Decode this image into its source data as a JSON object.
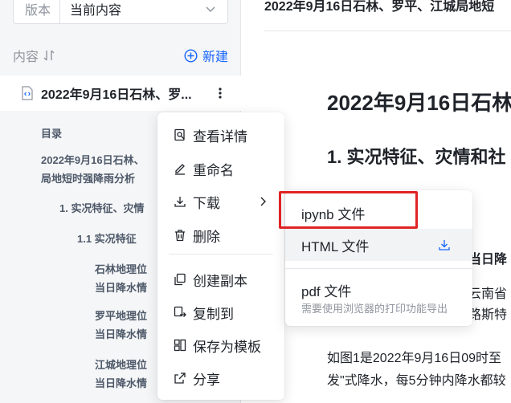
{
  "sidebar": {
    "version_label": "版本",
    "version_value": "当前内容",
    "content_title": "内容",
    "new_label": "新建",
    "file_title": "2022年9月16日石林、罗...",
    "toc_label": "目录",
    "toc": [
      "2022年9月16日石林、",
      "局地短时强降雨分析",
      "1. 实况特征、灾情",
      "1.1 实况特征",
      "石林地理位",
      "当日降水情",
      "罗平地理位",
      "当日降水情",
      "江城地理位",
      "当日降水情"
    ]
  },
  "main": {
    "top_title": "2022年9月16日石林、罗平、江城局地短",
    "h1": "2022年9月16日石林",
    "h2": "1. 实况特征、灾情和社",
    "frag_1": "当日降",
    "frag_2": "云南省",
    "frag_3": "路斯特",
    "para_1": "如图1是2022年9月16日09时至",
    "para_2": "发\"式降水，每5分钟内降水都较"
  },
  "context_menu": {
    "items": [
      "查看详情",
      "重命名",
      "下载",
      "删除",
      "创建副本",
      "复制到",
      "保存为模板",
      "分享"
    ]
  },
  "download_submenu": {
    "ipynb": "ipynb 文件",
    "html": "HTML 文件",
    "pdf": "pdf 文件",
    "pdf_hint": "需要使用浏览器的打印功能导出"
  },
  "colors": {
    "accent": "#1664ff",
    "highlight_border": "#e02424"
  }
}
